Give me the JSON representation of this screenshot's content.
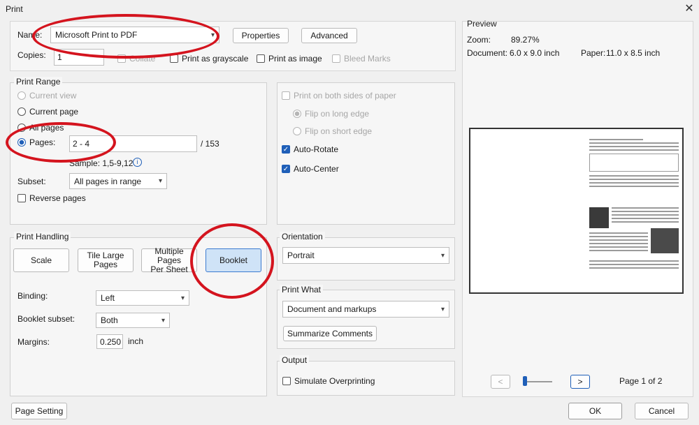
{
  "window": {
    "title": "Print",
    "close_glyph": "✕"
  },
  "printer": {
    "name_label": "Name:",
    "name_value": "Microsoft Print to PDF",
    "properties_label": "Properties",
    "advanced_label": "Advanced",
    "copies_label": "Copies:",
    "copies_value": "1",
    "collate_label": "Collate",
    "grayscale_label": "Print as grayscale",
    "image_label": "Print as image",
    "bleed_label": "Bleed Marks"
  },
  "print_range": {
    "legend": "Print Range",
    "current_view": "Current view",
    "current_page": "Current page",
    "all_pages": "All pages",
    "pages_label": "Pages:",
    "pages_value": "2 - 4",
    "pages_total": "/ 153",
    "sample": "Sample: 1,5-9,12",
    "info_glyph": "i",
    "subset_label": "Subset:",
    "subset_value": "All pages in range",
    "reverse_label": "Reverse pages"
  },
  "duplex": {
    "both_sides": "Print on both sides of paper",
    "flip_long": "Flip on long edge",
    "flip_short": "Flip on short edge",
    "auto_rotate": "Auto-Rotate",
    "auto_center": "Auto-Center"
  },
  "handling": {
    "legend": "Print Handling",
    "scale": "Scale",
    "tile_line1": "Tile Large",
    "tile_line2": "Pages",
    "multiple_line1": "Multiple Pages",
    "multiple_line2": "Per Sheet",
    "booklet": "Booklet",
    "binding_label": "Binding:",
    "binding_value": "Left",
    "subset_label": "Booklet subset:",
    "subset_value": "Both",
    "margins_label": "Margins:",
    "margins_value": "0.250",
    "margins_unit": "inch"
  },
  "orientation": {
    "legend": "Orientation",
    "value": "Portrait"
  },
  "print_what": {
    "legend": "Print What",
    "value": "Document and markups",
    "summarize": "Summarize Comments"
  },
  "output": {
    "legend": "Output",
    "simulate": "Simulate Overprinting"
  },
  "preview": {
    "legend": "Preview",
    "zoom_label": "Zoom:",
    "zoom_value": "89.27%",
    "document_label": "Document:",
    "document_value": "6.0 x 9.0 inch",
    "paper_label": "Paper:",
    "paper_value": "11.0 x 8.5 inch",
    "prev_glyph": "<",
    "next_glyph": ">",
    "page_indicator": "Page 1 of 2"
  },
  "footer": {
    "page_setting": "Page Setting",
    "ok": "OK",
    "cancel": "Cancel"
  },
  "colors": {
    "annotation_red": "#d4141e",
    "accent_blue": "#1f5fb8"
  }
}
